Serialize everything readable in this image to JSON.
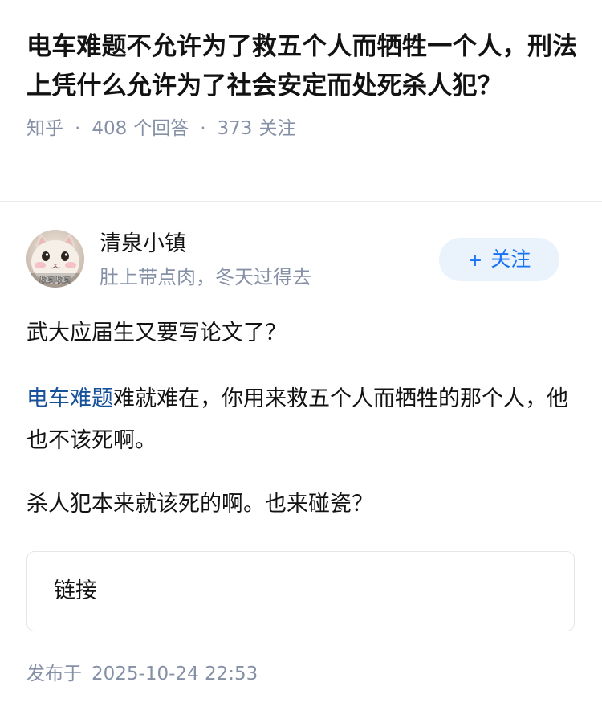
{
  "question": {
    "title": "电车难题不允许为了救五个人而牺牲一个人，刑法上凭什么允许为了社会安定而处死杀人犯？",
    "source": "知乎",
    "answer_count": "408",
    "answer_count_label": "个回答",
    "follower_count": "373",
    "follower_count_label": "关注"
  },
  "author": {
    "avatar_icon": "cat-avatar-icon",
    "avatar_caption": "收到收到",
    "name": "清泉小镇",
    "bio": "肚上带点肉，冬天过得去",
    "follow_label": "关注",
    "follow_icon": "plus-icon"
  },
  "answer": {
    "paragraph_1": "武大应届生又要写论文了？",
    "paragraph_2_link": "电车难题",
    "paragraph_2_rest": "难就难在，你用来救五个人而牺牲的那个人，他也不该死啊。",
    "paragraph_3": "杀人犯本来就该死的啊。也来碰瓷？"
  },
  "link_card": {
    "label": "链接"
  },
  "footer": {
    "published_label": "发布于",
    "published_time": "2025-10-24 22:53"
  },
  "colors": {
    "title": "#121212",
    "meta": "#8590a6",
    "link": "#175199",
    "follow_text": "#1772f6",
    "follow_bg": "#eaf2fb",
    "divider": "#ebebeb"
  }
}
